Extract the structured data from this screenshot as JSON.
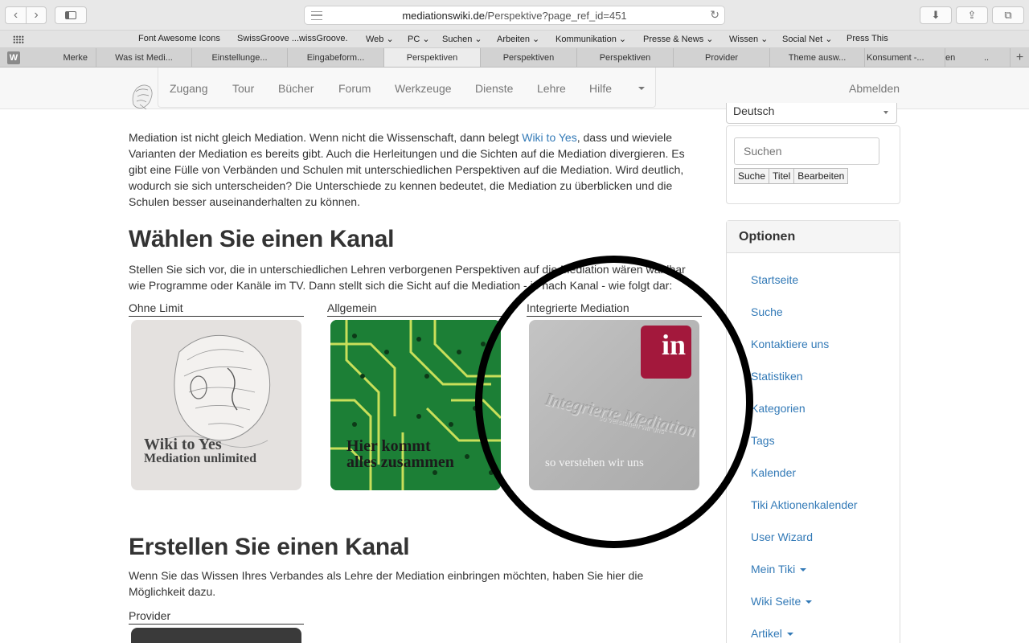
{
  "browser": {
    "url_domain": "mediationswiki.de",
    "url_path": "/Perspektive?page_ref_id=451",
    "back_icon": "chevron-left-icon",
    "forward_icon": "chevron-right-icon"
  },
  "bookmarks": [
    {
      "label": "Font Awesome Icons"
    },
    {
      "label": "SwissGroove ...wissGroove."
    },
    {
      "label": "Web ⌄"
    },
    {
      "label": "PC ⌄"
    },
    {
      "label": "Suchen ⌄"
    },
    {
      "label": "Arbeiten ⌄"
    },
    {
      "label": "Kommunikation ⌄"
    },
    {
      "label": "Presse & News ⌄"
    },
    {
      "label": "Wissen ⌄"
    },
    {
      "label": "Social Net ⌄"
    },
    {
      "label": "Press This"
    }
  ],
  "tabs": [
    {
      "label": "Merke"
    },
    {
      "label": "Was ist Medi..."
    },
    {
      "label": "Einstellunge..."
    },
    {
      "label": "Eingabeform..."
    },
    {
      "label": "Perspektiven"
    },
    {
      "label": "Perspektiven"
    },
    {
      "label": "Perspektiven"
    },
    {
      "label": "Provider"
    },
    {
      "label": "Theme ausw..."
    },
    {
      "label": "Konsument -..."
    },
    {
      "label": "en"
    },
    {
      "label": ".."
    }
  ],
  "tab_w_label": "W",
  "nav": {
    "items": [
      "Zugang",
      "Tour",
      "Bücher",
      "Forum",
      "Werkzeuge",
      "Dienste",
      "Lehre",
      "Hilfe"
    ],
    "logout": "Abmelden"
  },
  "intro": {
    "before_link": "Mediation ist nicht gleich Mediation. Wenn nicht die Wissenschaft, dann belegt ",
    "link": "Wiki to Yes",
    "after_link": ", dass und wieviele Varianten der Mediation es bereits gibt. Auch die Herleitungen und die Sichten auf die Mediation divergieren. Es gibt eine Fülle von Verbänden und Schulen mit unterschiedlichen Perspektiven auf die Mediation. Wird deutlich, wodurch sie sich unterscheiden? Die Unterschiede zu kennen bedeutet, die Mediation zu überblicken und die Schulen besser auseinanderhalten zu können."
  },
  "section1": {
    "title": "Wählen Sie einen Kanal",
    "text": "Stellen Sie sich vor, die in unterschiedlichen Lehren verborgenen Perspektiven auf die Mediation wären wählbar wie Programme oder Kanäle im TV. Dann stellt sich die Sicht auf die Mediation - je nach Kanal - wie folgt dar:",
    "channels": [
      {
        "label": "Ohne Limit",
        "img_line1": "Wiki to Yes",
        "img_line2": "Mediation unlimited"
      },
      {
        "label": "Allgemein",
        "img_line1": "Hier kommt",
        "img_line2": "alles zusammen"
      },
      {
        "label": "Integrierte Mediation",
        "badge": "in",
        "emboss": "Integrierte Mediation",
        "emboss_sub": "so verstehen wir uns",
        "caption": "so verstehen wir uns"
      }
    ]
  },
  "section2": {
    "title": "Erstellen Sie einen Kanal",
    "text": "Wenn Sie das Wissen Ihres Verbandes als Lehre der Mediation einbringen möchten, haben Sie hier die Möglichkeit dazu.",
    "provider_label": "Provider"
  },
  "sidebar": {
    "language": "Deutsch",
    "search_placeholder": "Suchen",
    "search_buttons": [
      "Suche",
      "Titel",
      "Bearbeiten"
    ],
    "options_title": "Optionen",
    "options": [
      {
        "label": "Startseite",
        "caret": false
      },
      {
        "label": "Suche",
        "caret": false
      },
      {
        "label": "Kontaktiere uns",
        "caret": false
      },
      {
        "label": "Statistiken",
        "caret": false
      },
      {
        "label": "Kategorien",
        "caret": false
      },
      {
        "label": "Tags",
        "caret": false
      },
      {
        "label": "Kalender",
        "caret": false
      },
      {
        "label": "Tiki Aktionenkalender",
        "caret": false
      },
      {
        "label": "User Wizard",
        "caret": false
      },
      {
        "label": "Mein Tiki",
        "caret": true
      },
      {
        "label": "Wiki Seite",
        "caret": true
      },
      {
        "label": "Artikel",
        "caret": true
      }
    ]
  },
  "colors": {
    "link": "#337ab7",
    "badge": "#a3183c",
    "circuit": "#1f8a3a"
  }
}
